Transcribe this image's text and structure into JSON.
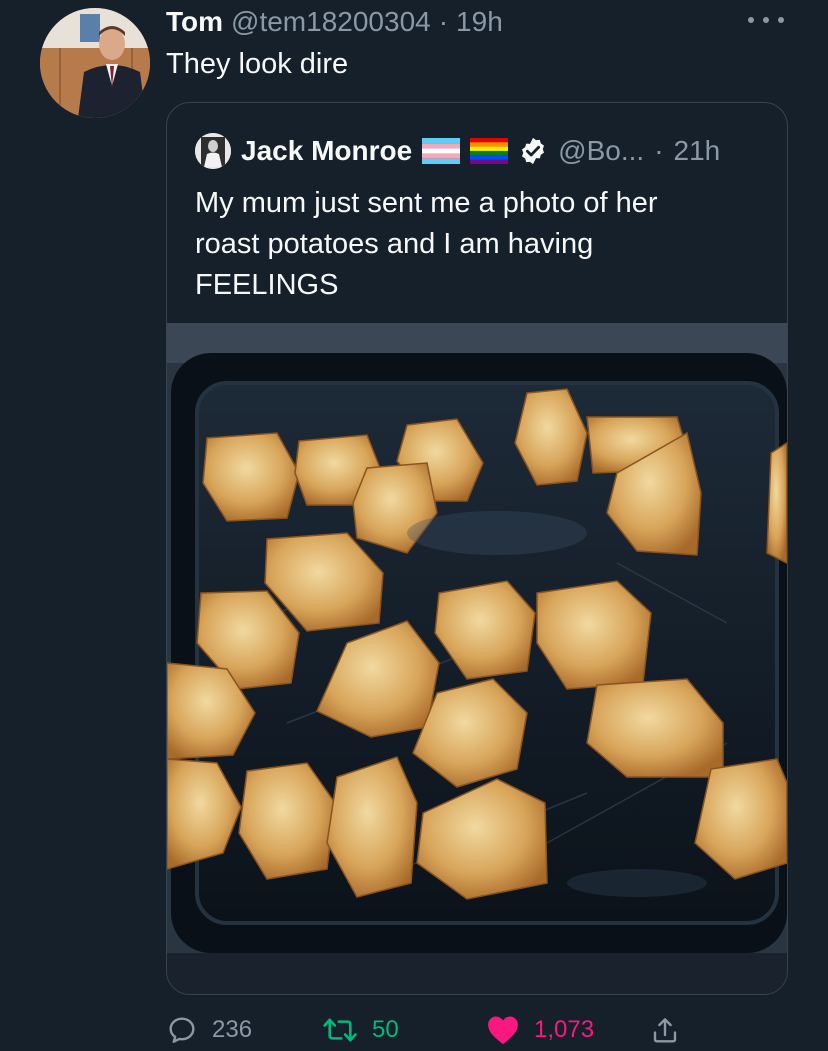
{
  "author": {
    "name": "Tom",
    "handle": "@tem18200304",
    "time": "19h",
    "text": "They look dire"
  },
  "quoted": {
    "name": "Jack Monroe",
    "handle": "@Bo...",
    "time": "21h",
    "text_lines": [
      "My mum just sent me a photo of her",
      "roast potatoes and I am having",
      "FEELINGS"
    ],
    "media_description_icon": "photo-roast-potatoes"
  },
  "actions": {
    "reply_count": "236",
    "retweet_count": "50",
    "like_count": "1,073"
  },
  "colors": {
    "background": "#15202b",
    "text": "#f7f9f9",
    "muted": "#8b98a5",
    "border": "#38444d",
    "retweet": "#00ba7c",
    "like": "#f91880",
    "verified": "#f7f9f9"
  }
}
